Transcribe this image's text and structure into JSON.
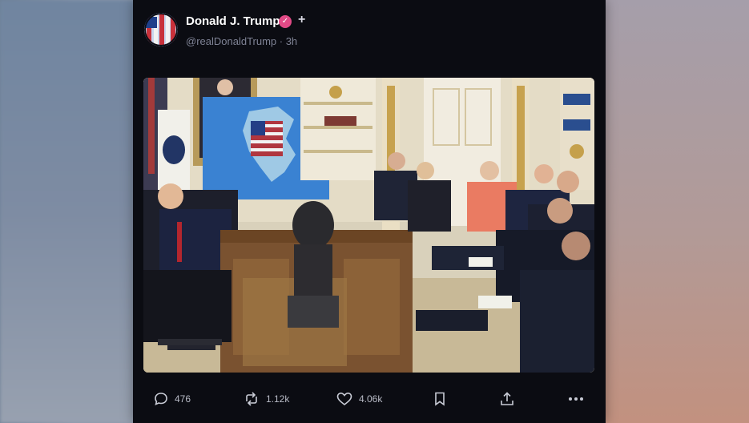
{
  "post": {
    "author": {
      "display_name": "Donald J. Trump",
      "handle": "@realDonaldTrump",
      "time": "3h",
      "handle_line": "@realDonaldTrump · 3h",
      "verified_icon": "verified-badge-icon",
      "follow_icon": "plus-icon"
    },
    "image": {
      "icon": "photo"
    },
    "actions": {
      "replies": "476",
      "reposts": "1.12k",
      "likes": "4.06k"
    }
  },
  "colors": {
    "card_bg": "#0b0c12",
    "badge": "#e14a86",
    "text_primary": "#ffffff",
    "text_muted": "#7e8294"
  }
}
